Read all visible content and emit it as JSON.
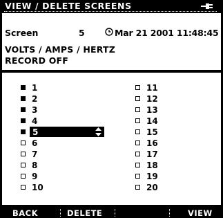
{
  "header": {
    "title": "VIEW / DELETE SCREENS",
    "status_icon": "plug-icon"
  },
  "info": {
    "screen_label": "Screen",
    "screen_number": "5",
    "clock_icon": "clock-icon",
    "datetime": "Mar 21 2001  11:48:45",
    "mode": "VOLTS / AMPS / HERTZ",
    "record_status": "RECORD OFF"
  },
  "screens": [
    {
      "label": "1",
      "filled": true
    },
    {
      "label": "2",
      "filled": true
    },
    {
      "label": "3",
      "filled": true
    },
    {
      "label": "4",
      "filled": true
    },
    {
      "label": "5",
      "filled": true
    },
    {
      "label": "6",
      "filled": false
    },
    {
      "label": "7",
      "filled": false
    },
    {
      "label": "8",
      "filled": false
    },
    {
      "label": "9",
      "filled": false
    },
    {
      "label": "10",
      "filled": false
    },
    {
      "label": "11",
      "filled": false
    },
    {
      "label": "12",
      "filled": false
    },
    {
      "label": "13",
      "filled": false
    },
    {
      "label": "14",
      "filled": false
    },
    {
      "label": "15",
      "filled": false
    },
    {
      "label": "16",
      "filled": false
    },
    {
      "label": "17",
      "filled": false
    },
    {
      "label": "18",
      "filled": false
    },
    {
      "label": "19",
      "filled": false
    },
    {
      "label": "20",
      "filled": false
    }
  ],
  "selected_screen": "5",
  "softkeys": {
    "key1": "BACK",
    "key2": "DELETE",
    "key3": "",
    "key4": "VIEW"
  }
}
